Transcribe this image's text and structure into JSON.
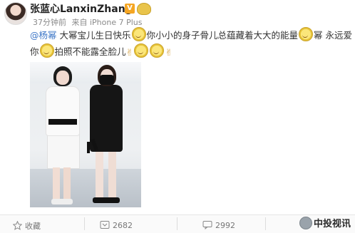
{
  "header": {
    "username": "张蓝心LanxinZhang",
    "verified_badge": "V",
    "timestamp": "37分钟前",
    "source": "来自 iPhone 7 Plus"
  },
  "post": {
    "mention": "@杨幂",
    "text1": " 大幂宝儿生日快乐",
    "text2": "你小小的身子骨儿总蕴藏着大大的能量",
    "text3": "幂 永远爱",
    "text4": "你",
    "text5": "拍照不能露全脸儿"
  },
  "actions": {
    "favorite": "收藏",
    "repost": "2682",
    "comment": "2992"
  },
  "watermark": {
    "text": "中投视讯"
  },
  "colors": {
    "mention": "#3e77c7",
    "verified": "#f5a623"
  }
}
